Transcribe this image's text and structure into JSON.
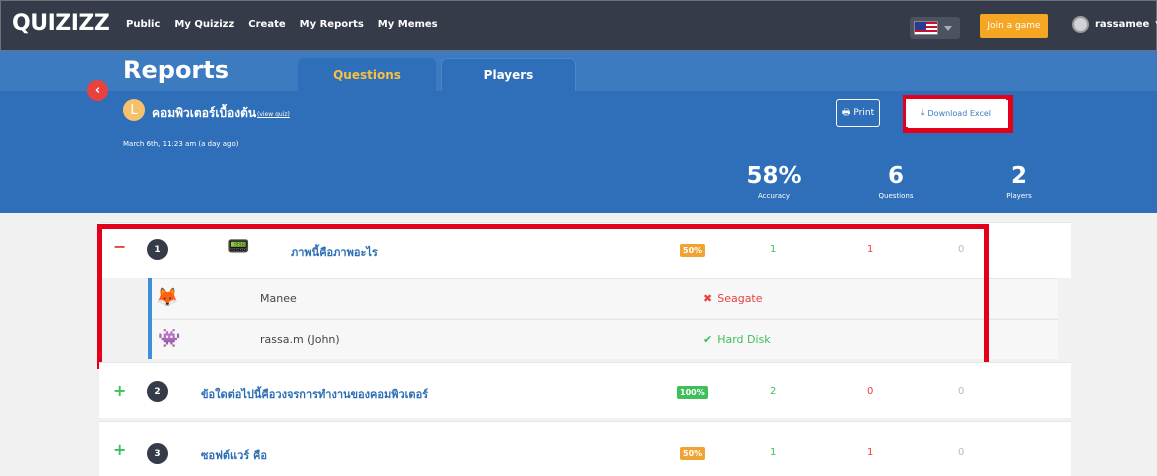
{
  "nav": {
    "logo": "QUIZIZZ",
    "links": [
      "Public",
      "My Quizizz",
      "Create",
      "My Reports",
      "My Memes"
    ],
    "join_button": "Join a game",
    "username": "rassamee"
  },
  "report": {
    "title": "Reports",
    "tabs": [
      "Questions",
      "Players"
    ],
    "quiz_initial": "L",
    "quiz_title": "คอมพิวเตอร์เบื้องต้น",
    "view_quiz": "(view quiz)",
    "date": "March 6th, 11:23 am (a day ago)",
    "print_label": "Print",
    "download_label": "Download Excel",
    "stats": [
      {
        "value": "58%",
        "label": "Accuracy"
      },
      {
        "value": "6",
        "label": "Questions"
      },
      {
        "value": "2",
        "label": "Players"
      }
    ]
  },
  "questions": [
    {
      "number": "1",
      "text": "ภาพนี้คือภาพอะไร",
      "percent": "50%",
      "percent_color": "orange",
      "correct": "1",
      "wrong": "1",
      "skipped": "0",
      "expanded": true,
      "answers": [
        {
          "player": "Manee",
          "answer": "Seagate",
          "correct": false
        },
        {
          "player": "rassa.m (John)",
          "answer": "Hard Disk",
          "correct": true
        }
      ]
    },
    {
      "number": "2",
      "text": "ข้อใดต่อไปนี้คือวงจรการทำงานของคอมพิวเตอร์",
      "percent": "100%",
      "percent_color": "green",
      "correct": "2",
      "wrong": "0",
      "skipped": "0",
      "expanded": false
    },
    {
      "number": "3",
      "text": "ซอฟต์แวร์ คือ",
      "percent": "50%",
      "percent_color": "orange",
      "correct": "1",
      "wrong": "1",
      "skipped": "0",
      "expanded": false
    }
  ]
}
